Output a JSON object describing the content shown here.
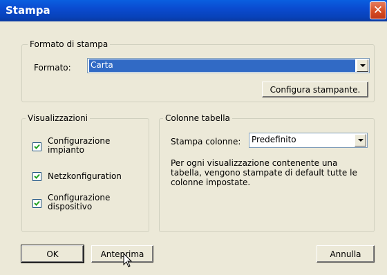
{
  "window": {
    "title": "Stampa"
  },
  "format_group": {
    "legend": "Formato di stampa",
    "format_label": "Formato:",
    "format_value": "Carta",
    "configure_button": "Configura stampante."
  },
  "views_group": {
    "legend": "Visualizzazioni",
    "items": [
      {
        "label_line1": "Configurazione",
        "label_line2": "impianto",
        "checked": true
      },
      {
        "label_line1": "Netzkonfiguration",
        "label_line2": "",
        "checked": true
      },
      {
        "label_line1": "Configurazione",
        "label_line2": "dispositivo",
        "checked": true
      }
    ]
  },
  "columns_group": {
    "legend": "Colonne tabella",
    "columns_label": "Stampa colonne:",
    "columns_value": "Predefinito",
    "description_line1": "Per ogni visualizzazione contenente una",
    "description_line2": "tabella, vengono stampate di default tutte le",
    "description_line3": "colonne impostate."
  },
  "buttons": {
    "ok": "OK",
    "preview": "Anteprima",
    "cancel": "Annulla"
  },
  "icons": {
    "close": "close-icon",
    "dropdown": "chevron-down-icon",
    "check": "checkmark-icon",
    "cursor": "mouse-pointer-icon"
  }
}
